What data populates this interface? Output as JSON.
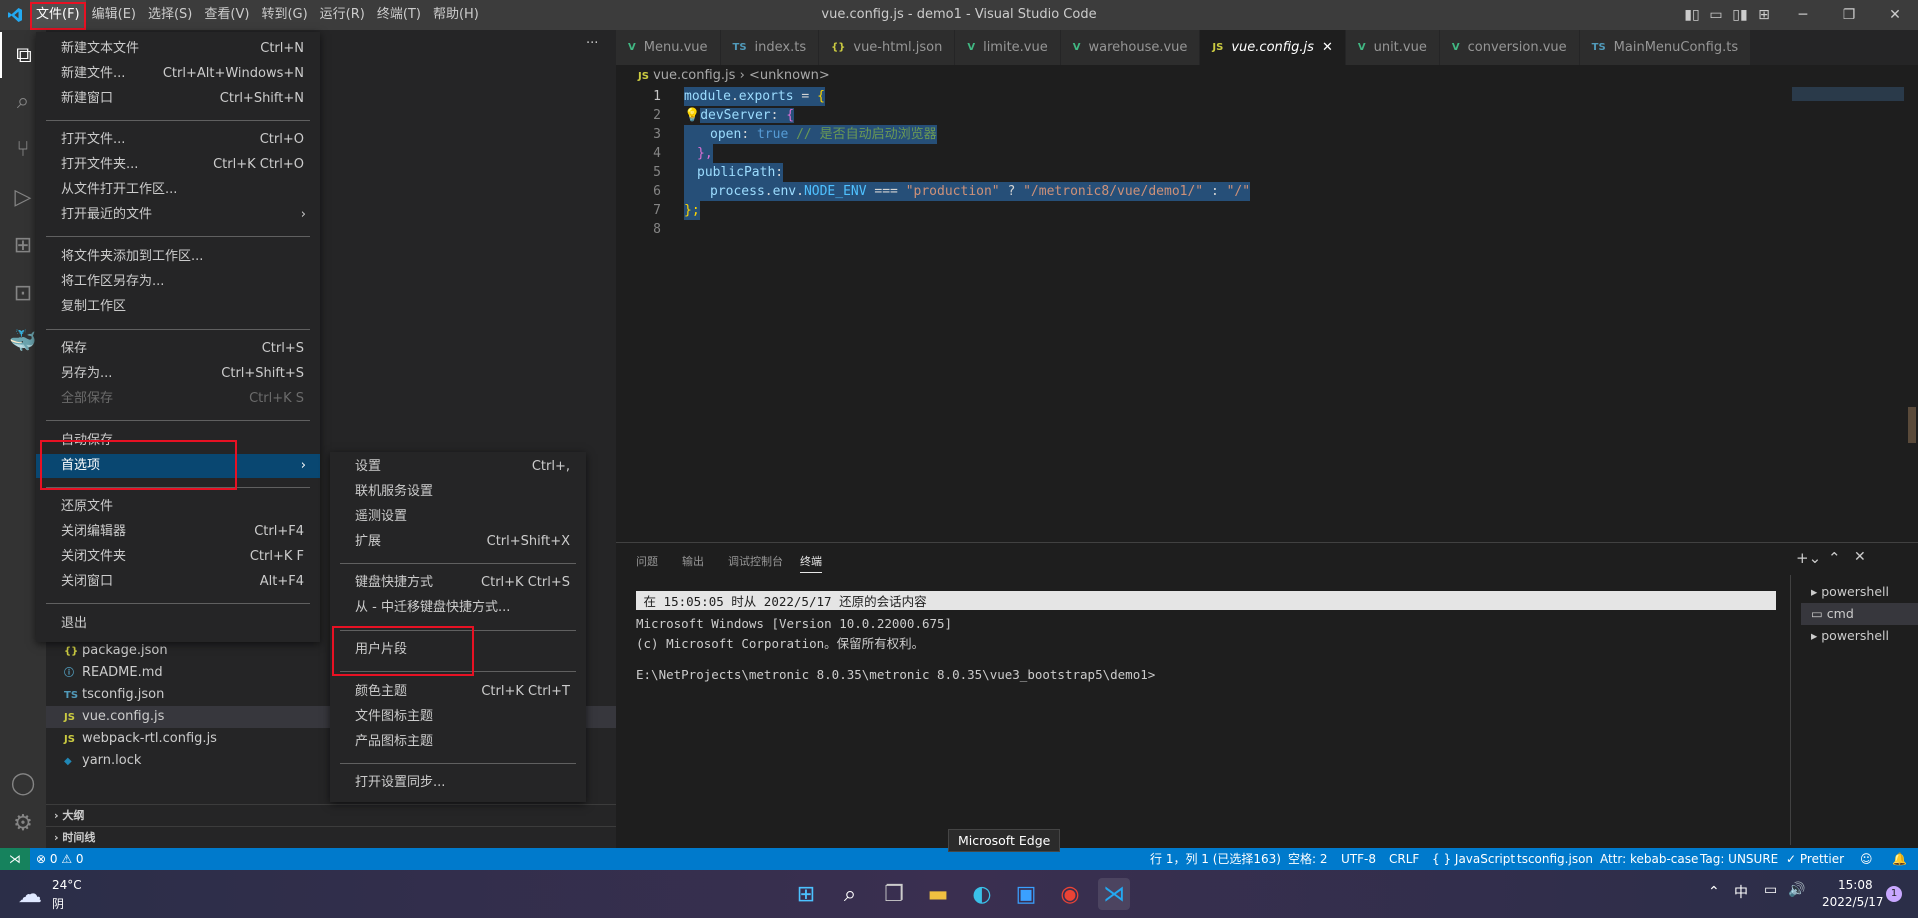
{
  "window": {
    "title": "vue.config.js - demo1 - Visual Studio Code",
    "menu": [
      "文件(F)",
      "编辑(E)",
      "选择(S)",
      "查看(V)",
      "转到(G)",
      "运行(R)",
      "终端(T)",
      "帮助(H)"
    ]
  },
  "sidebar": {
    "more": "···",
    "files": [
      {
        "icon": "{}",
        "name": "package.json"
      },
      {
        "icon": "ⓘ",
        "name": "README.md"
      },
      {
        "icon": "TS",
        "name": "tsconfig.json"
      },
      {
        "icon": "JS",
        "name": "vue.config.js",
        "selected": true
      },
      {
        "icon": "JS",
        "name": "webpack-rtl.config.js"
      },
      {
        "icon": "◆",
        "name": "yarn.lock"
      }
    ],
    "sections": [
      "大纲",
      "时间线"
    ]
  },
  "tabs": [
    {
      "icon": "V",
      "label": "Menu.vue"
    },
    {
      "icon": "TS",
      "label": "index.ts"
    },
    {
      "icon": "{}",
      "label": "vue-html.json"
    },
    {
      "icon": "V",
      "label": "limite.vue"
    },
    {
      "icon": "V",
      "label": "warehouse.vue"
    },
    {
      "icon": "JS",
      "label": "vue.config.js",
      "active": true
    },
    {
      "icon": "V",
      "label": "unit.vue"
    },
    {
      "icon": "V",
      "label": "conversion.vue"
    },
    {
      "icon": "TS",
      "label": "MainMenuConfig.ts"
    }
  ],
  "breadcrumb": {
    "file": "vue.config.js",
    "symbol": "<unknown>"
  },
  "code": {
    "line_numbers": [
      "1",
      "2",
      "3",
      "4",
      "5",
      "6",
      "7",
      "8"
    ],
    "l1": [
      "module",
      ".",
      "exports",
      " = ",
      "{"
    ],
    "l2": [
      "devServer",
      ": ",
      "{"
    ],
    "l3": [
      "open",
      ": ",
      "true",
      " // 是否自动启动浏览器"
    ],
    "l4": [
      "},"
    ],
    "l5": [
      "publicPath",
      ":"
    ],
    "l6": [
      "process",
      ".",
      "env",
      ".",
      "NODE_ENV",
      " === ",
      "\"production\"",
      " ? ",
      "\"/metronic8/vue/demo1/\"",
      " : ",
      "\"/\""
    ],
    "l7": [
      "};"
    ]
  },
  "panel": {
    "tabs": [
      "问题",
      "输出",
      "调试控制台",
      "终端"
    ],
    "terminal": {
      "banner": " 在 15:05:05 时从 2022/5/17 还原的会话内容",
      "lines": [
        "Microsoft Windows [Version 10.0.22000.675]",
        "(c) Microsoft Corporation。保留所有权利。",
        "",
        "E:\\NetProjects\\metronic 8.0.35\\metronic 8.0.35\\vue3_bootstrap5\\demo1>"
      ]
    },
    "terminals": [
      "powershell",
      "cmd",
      "powershell"
    ]
  },
  "file_menu": [
    {
      "label": "新建文本文件",
      "shortcut": "Ctrl+N"
    },
    {
      "label": "新建文件...",
      "shortcut": "Ctrl+Alt+Windows+N"
    },
    {
      "label": "新建窗口",
      "shortcut": "Ctrl+Shift+N"
    },
    {
      "label": "打开文件...",
      "shortcut": "Ctrl+O"
    },
    {
      "label": "打开文件夹...",
      "shortcut": "Ctrl+K Ctrl+O"
    },
    {
      "label": "从文件打开工作区...",
      "shortcut": ""
    },
    {
      "label": "打开最近的文件",
      "shortcut": ""
    },
    {
      "label": "将文件夹添加到工作区...",
      "shortcut": ""
    },
    {
      "label": "将工作区另存为...",
      "shortcut": ""
    },
    {
      "label": "复制工作区",
      "shortcut": ""
    },
    {
      "label": "保存",
      "shortcut": "Ctrl+S"
    },
    {
      "label": "另存为...",
      "shortcut": "Ctrl+Shift+S"
    },
    {
      "label": "全部保存",
      "shortcut": "Ctrl+K S"
    },
    {
      "label": "自动保存",
      "shortcut": ""
    },
    {
      "label": "首选项",
      "shortcut": ""
    },
    {
      "label": "还原文件",
      "shortcut": ""
    },
    {
      "label": "关闭编辑器",
      "shortcut": "Ctrl+F4"
    },
    {
      "label": "关闭文件夹",
      "shortcut": "Ctrl+K F"
    },
    {
      "label": "关闭窗口",
      "shortcut": "Alt+F4"
    },
    {
      "label": "退出",
      "shortcut": ""
    }
  ],
  "prefs_menu": [
    {
      "label": "设置",
      "shortcut": "Ctrl+,"
    },
    {
      "label": "联机服务设置",
      "shortcut": ""
    },
    {
      "label": "遥测设置",
      "shortcut": ""
    },
    {
      "label": "扩展",
      "shortcut": "Ctrl+Shift+X"
    },
    {
      "label": "键盘快捷方式",
      "shortcut": "Ctrl+K Ctrl+S"
    },
    {
      "label": "从 - 中迁移键盘快捷方式...",
      "shortcut": ""
    },
    {
      "label": "用户片段",
      "shortcut": ""
    },
    {
      "label": "颜色主题",
      "shortcut": "Ctrl+K Ctrl+T"
    },
    {
      "label": "文件图标主题",
      "shortcut": ""
    },
    {
      "label": "产品图标主题",
      "shortcut": ""
    },
    {
      "label": "打开设置同步...",
      "shortcut": ""
    }
  ],
  "statusbar": {
    "problems": "⊗ 0 ⚠ 0",
    "position": "行 1，列 1 (已选择163)",
    "spaces": "空格: 2",
    "encoding": "UTF-8",
    "eol": "CRLF",
    "language": "{ } JavaScript",
    "tsconfig": "tsconfig.json",
    "attr": "Attr: kebab-case",
    "tag": "Tag: UNSURE",
    "prettier": "✓ Prettier"
  },
  "tooltip": "Microsoft Edge",
  "taskbar": {
    "temp": "24°C",
    "weather": "阴",
    "time": "15:08",
    "date": "2022/5/17",
    "ime": "中",
    "notifications": "1"
  },
  "colors": {
    "accent": "#007acc",
    "highlight": "#094771",
    "annotation": "#e81123"
  }
}
